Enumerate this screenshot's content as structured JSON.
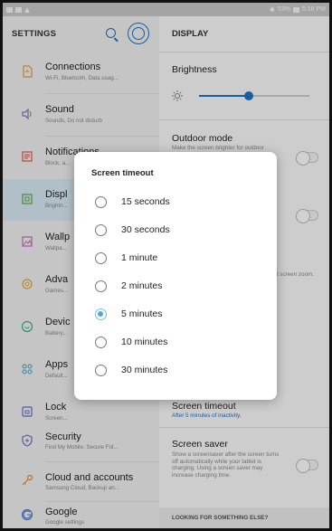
{
  "status": {
    "time": "5:18 PM",
    "battery": "53%"
  },
  "left": {
    "title": "SETTINGS",
    "items": [
      {
        "name": "connections",
        "title": "Connections",
        "sub": "Wi-Fi, Bluetooth, Data usag..."
      },
      {
        "name": "sound",
        "title": "Sound",
        "sub": "Sounds, Do not disturb"
      },
      {
        "name": "notifications",
        "title": "Notifications",
        "sub": "Block, a..."
      },
      {
        "name": "display",
        "title": "Displ",
        "sub": "Brightn..."
      },
      {
        "name": "wallpapers",
        "title": "Wallp",
        "sub": "Wallpa..."
      },
      {
        "name": "advanced",
        "title": "Adva",
        "sub": "Games..."
      },
      {
        "name": "device",
        "title": "Devic",
        "sub": "Battery..."
      },
      {
        "name": "apps",
        "title": "Apps",
        "sub": "Default..."
      },
      {
        "name": "lock",
        "title": "Lock",
        "sub": "Screen..."
      },
      {
        "name": "security",
        "title": "Security",
        "sub": "Find My Mobile, Secure Fol..."
      },
      {
        "name": "cloud",
        "title": "Cloud and accounts",
        "sub": "Samsung Cloud, Backup an..."
      },
      {
        "name": "google",
        "title": "Google",
        "sub": "Google settings"
      }
    ]
  },
  "right": {
    "title": "DISPLAY",
    "brightness": {
      "label": "Brightness",
      "level": 0.45
    },
    "outdoor": {
      "title": "Outdoor mode",
      "sub": "Make the screen brighter for outdoor"
    },
    "zoom_fragment": "d screen zoom.",
    "screen_timeout": {
      "title": "Screen timeout",
      "sub": "After 5 minutes of inactivity."
    },
    "screen_saver": {
      "title": "Screen saver",
      "sub": "Show a screensaver after the screen turns off automatically while your tablet is charging. Using a screen saver may increase charging time."
    },
    "find": "LOOKING FOR SOMETHING ELSE?"
  },
  "dialog": {
    "title": "Screen timeout",
    "options": [
      "15 seconds",
      "30 seconds",
      "1 minute",
      "2 minutes",
      "5 minutes",
      "10 minutes",
      "30 minutes"
    ],
    "selected": 4
  },
  "colors": {
    "accent": "#1a73c9",
    "selected_bg": "#d8ebf5",
    "radio_checked": "#4aa7e0"
  }
}
